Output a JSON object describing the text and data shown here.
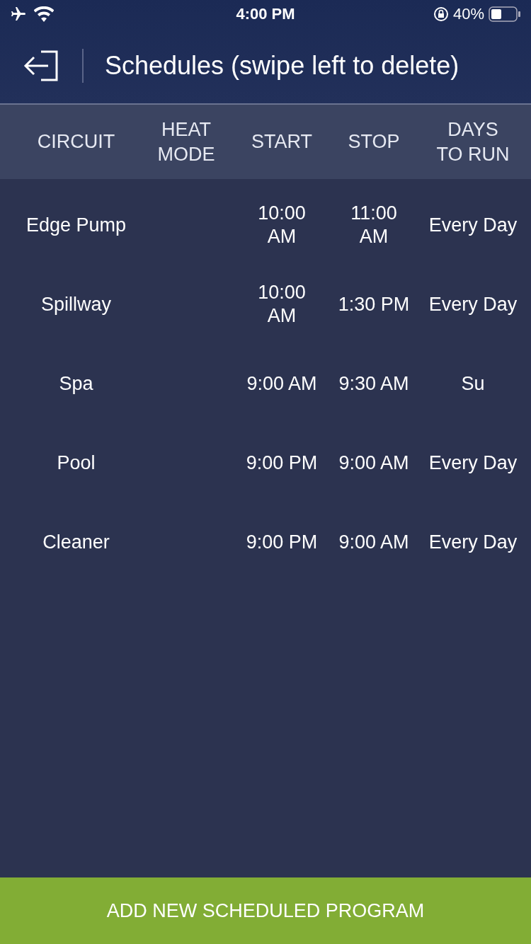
{
  "status_bar": {
    "time": "4:00 PM",
    "battery": "40%"
  },
  "header": {
    "title": "Schedules (swipe left to delete)"
  },
  "table": {
    "columns": [
      "CIRCUIT",
      "HEAT\nMODE",
      "START",
      "STOP",
      "DAYS\nTO RUN"
    ],
    "rows": [
      {
        "circuit": "Edge Pump",
        "start": "10:00\nAM",
        "stop": "11:00\nAM",
        "days": "Every Day"
      },
      {
        "circuit": "Spillway",
        "start": "10:00\nAM",
        "stop": "1:30 PM",
        "days": "Every Day"
      },
      {
        "circuit": "Spa",
        "start": "9:00 AM",
        "stop": "9:30 AM",
        "days": "Su"
      },
      {
        "circuit": "Pool",
        "start": "9:00 PM",
        "stop": "9:00 AM",
        "days": "Every Day"
      },
      {
        "circuit": "Cleaner",
        "start": "9:00 PM",
        "stop": "9:00 AM",
        "days": "Every Day"
      }
    ]
  },
  "add_button": "ADD NEW SCHEDULED PROGRAM"
}
